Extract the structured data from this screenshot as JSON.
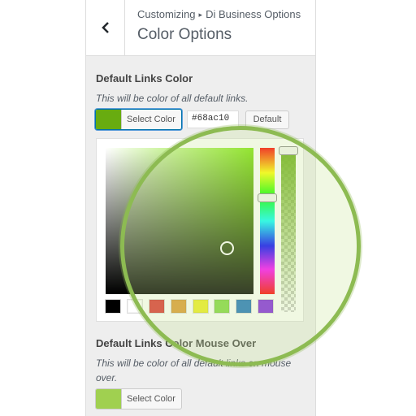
{
  "header": {
    "breadcrumb_root": "Customizing",
    "breadcrumb_separator": "▸",
    "breadcrumb_section": "Di Business Options",
    "title": "Color Options",
    "back_icon": "chevron-left-icon"
  },
  "links_color": {
    "title": "Default Links Color",
    "description": "This will be color of all default links.",
    "select_label": "Select Color",
    "hex_value": "#68ac10",
    "default_label": "Default",
    "swatch_color": "#68ac10"
  },
  "picker": {
    "selected_color": "#68ac10",
    "hue_color": "#7fe50a",
    "palette": [
      "#000000",
      "#ffffff",
      "#dd3333",
      "#dd9933",
      "#eeee22",
      "#81d742",
      "#1e73be",
      "#8224e3"
    ]
  },
  "links_hover_color": {
    "title": "Default Links Color Mouse Over",
    "description_line1": "This will be color of all default links on mouse",
    "description_line2": "over.",
    "select_label": "Select Color",
    "swatch_color": "#a0d050"
  }
}
